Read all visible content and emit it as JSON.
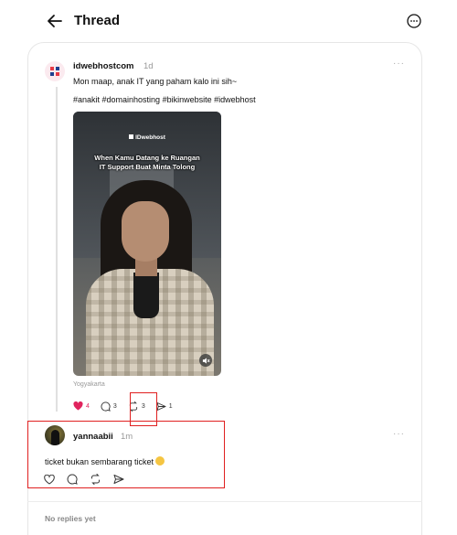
{
  "header": {
    "title": "Thread",
    "back_icon": "arrow-left-icon",
    "menu_icon": "more-circle-icon"
  },
  "post": {
    "username": "idwebhostcom",
    "time": "1d",
    "text": "Mon maap, anak IT yang paham kalo ini sih~",
    "hashtags": "#anakit #domainhosting #bikinwebsite #idwebhost",
    "more": "···",
    "video": {
      "brand": "IDwebhost",
      "overlay_line1": "When Kamu Datang ke Ruangan",
      "overlay_line2": "IT Support Buat Minta Tolong"
    },
    "location": "Yogyakarta",
    "likes": "4",
    "comments": "3",
    "reposts": "3",
    "shares": "1",
    "like_color": "#e0245e"
  },
  "reply": {
    "username": "yannaabii",
    "time": "1m",
    "text": "ticket bukan sembarang ticket",
    "more": "···"
  },
  "footer": {
    "no_replies": "No replies yet"
  },
  "annotations": {
    "highlight_color": "#e02020"
  }
}
